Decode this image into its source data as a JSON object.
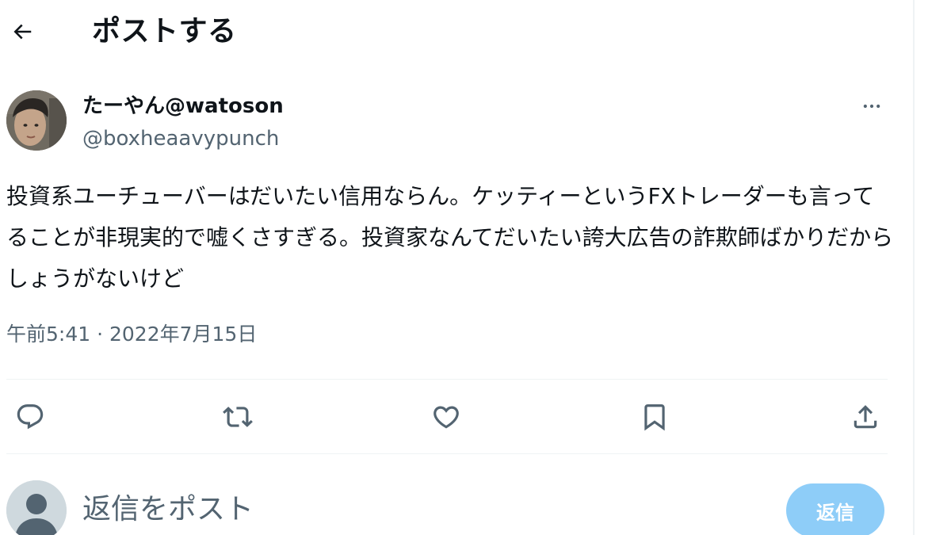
{
  "header": {
    "title": "ポストする",
    "back_icon": "arrow-left-icon"
  },
  "tweet": {
    "author": {
      "display_name": "たーやん@watoson",
      "handle": "@boxheaavypunch"
    },
    "text": "投資系ユーチューバーはだいたい信用ならん。ケッティーというFXトレーダーも言ってることが非現実的で嘘くさすぎる。投資家なんてだいたい誇大広告の詐欺師ばかりだからしょうがないけど",
    "timestamp": "午前5:41 · 2022年7月15日"
  },
  "actions": [
    {
      "name": "reply",
      "icon": "comment-icon"
    },
    {
      "name": "repost",
      "icon": "repost-icon"
    },
    {
      "name": "like",
      "icon": "heart-icon"
    },
    {
      "name": "bookmark",
      "icon": "bookmark-icon"
    },
    {
      "name": "share",
      "icon": "share-icon"
    }
  ],
  "reply_composer": {
    "placeholder": "返信をポスト",
    "button_label": "返信"
  },
  "colors": {
    "text_primary": "#0f1419",
    "text_secondary": "#536471",
    "icon": "#536471",
    "divider": "#eff3f4",
    "reply_button_disabled": "#8ecdf8"
  }
}
